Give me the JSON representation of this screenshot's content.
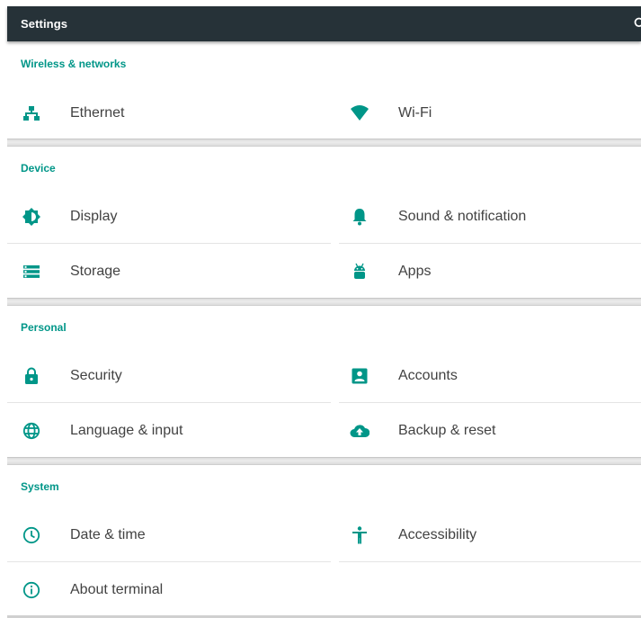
{
  "app_bar": {
    "title": "Settings",
    "search_icon": "search-icon"
  },
  "colors": {
    "accent": "#009688",
    "app_bar": "#263238"
  },
  "sections": [
    {
      "title": "Wireless & networks",
      "items": [
        {
          "label": "Ethernet",
          "icon": "ethernet-icon"
        },
        {
          "label": "Wi-Fi",
          "icon": "wifi-icon"
        }
      ]
    },
    {
      "title": "Device",
      "items": [
        {
          "label": "Display",
          "icon": "brightness-icon"
        },
        {
          "label": "Sound & notification",
          "icon": "bell-icon"
        },
        {
          "label": "Storage",
          "icon": "storage-icon"
        },
        {
          "label": "Apps",
          "icon": "android-icon"
        }
      ]
    },
    {
      "title": "Personal",
      "items": [
        {
          "label": "Security",
          "icon": "lock-icon"
        },
        {
          "label": "Accounts",
          "icon": "account-box-icon"
        },
        {
          "label": "Language & input",
          "icon": "globe-icon"
        },
        {
          "label": "Backup & reset",
          "icon": "cloud-upload-icon"
        }
      ]
    },
    {
      "title": "System",
      "items": [
        {
          "label": "Date & time",
          "icon": "clock-icon"
        },
        {
          "label": "Accessibility",
          "icon": "accessibility-icon"
        },
        {
          "label": "About terminal",
          "icon": "info-icon"
        }
      ]
    }
  ]
}
